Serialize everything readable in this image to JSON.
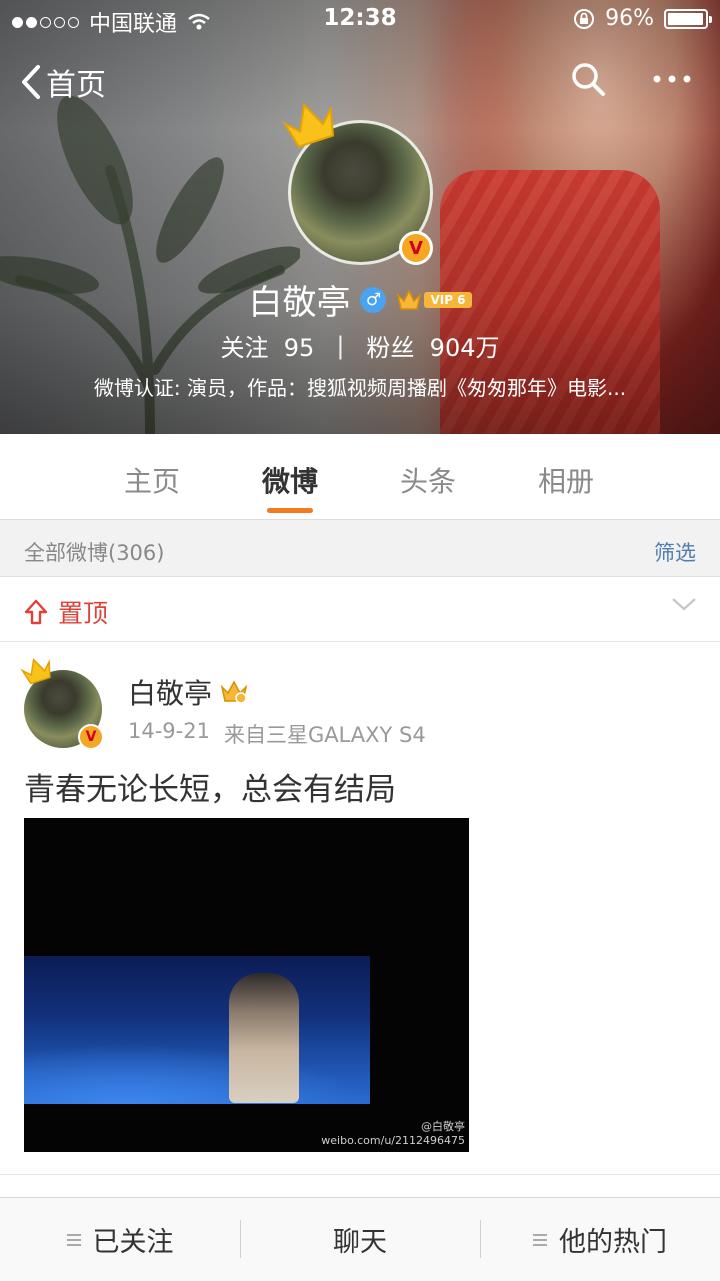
{
  "status_bar": {
    "carrier": "中国联通",
    "signal_dots_filled": 2,
    "signal_dots_total": 5,
    "time": "12:38",
    "battery_percent_text": "96%",
    "battery_level": 0.96
  },
  "nav": {
    "back_label": "首页"
  },
  "profile": {
    "name": "白敬亭",
    "vip_label": "VIP 6",
    "following_label": "关注",
    "following_count": "95",
    "separator": "|",
    "followers_label": "粉丝",
    "followers_count": "904万",
    "verification": "微博认证: 演员，作品：搜狐视频周播剧《匆匆那年》电影..."
  },
  "tabs": [
    {
      "label": "主页",
      "active": false
    },
    {
      "label": "微博",
      "active": true
    },
    {
      "label": "头条",
      "active": false
    },
    {
      "label": "相册",
      "active": false
    }
  ],
  "feed": {
    "count_label": "全部微博(306)",
    "filter_label": "筛选",
    "pinned_label": "置顶"
  },
  "post": {
    "author": "白敬亭",
    "date": "14-9-21",
    "source": "来自三星GALAXY S4",
    "text": "青春无论长短，总会有结局",
    "watermark_line1": "@白敬亭",
    "watermark_line2": "weibo.com/u/2112496475"
  },
  "bottom_bar": {
    "followed_label": "已关注",
    "chat_label": "聊天",
    "hot_label": "他的热门"
  },
  "colors": {
    "accent_orange": "#f47a20",
    "pinned_red": "#e0403a",
    "link_blue": "#507daf",
    "vip_gold": "#f6b63a",
    "verify_badge": "#f5a623"
  }
}
